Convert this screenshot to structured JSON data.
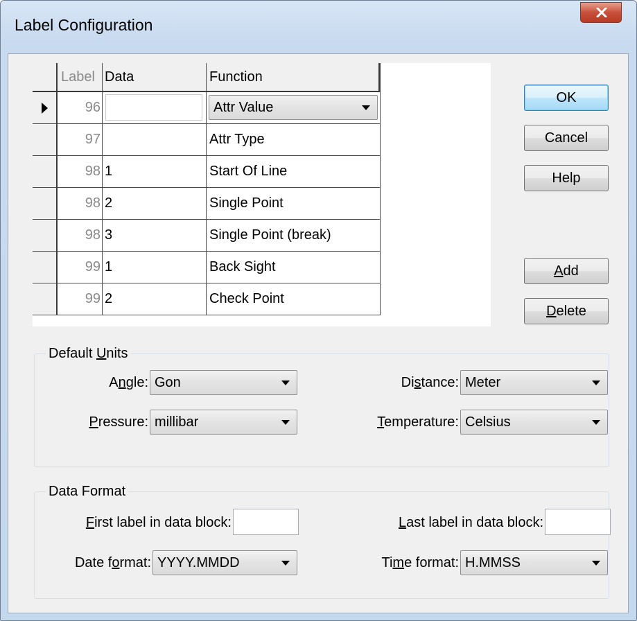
{
  "window": {
    "title": "Label Configuration",
    "close_symbol": "✕"
  },
  "table": {
    "headers": {
      "label": "Label",
      "data": "Data",
      "function": "Function"
    },
    "rows": [
      {
        "label": "96",
        "data": "",
        "function": "Attr Value",
        "current": true,
        "editing": true
      },
      {
        "label": "97",
        "data": "",
        "function": "Attr Type"
      },
      {
        "label": "98",
        "data": "1",
        "function": "Start Of Line"
      },
      {
        "label": "98",
        "data": "2",
        "function": "Single Point"
      },
      {
        "label": "98",
        "data": "3",
        "function": "Single Point (break)"
      },
      {
        "label": "99",
        "data": "1",
        "function": "Back Sight"
      },
      {
        "label": "99",
        "data": "2",
        "function": "Check Point"
      }
    ]
  },
  "buttons": {
    "ok": "OK",
    "cancel": "Cancel",
    "help": "Help",
    "add": {
      "pre": "",
      "mnemonic": "A",
      "post": "dd"
    },
    "delete": {
      "pre": "",
      "mnemonic": "D",
      "post": "elete"
    }
  },
  "default_units": {
    "title": {
      "pre": "Default ",
      "mnemonic": "U",
      "post": "nits"
    },
    "angle": {
      "label": {
        "pre": "A",
        "mnemonic": "n",
        "post": "gle:"
      },
      "value": "Gon"
    },
    "distance": {
      "label": {
        "pre": "Di",
        "mnemonic": "s",
        "post": "tance:"
      },
      "value": "Meter"
    },
    "pressure": {
      "label": {
        "pre": "",
        "mnemonic": "P",
        "post": "ressure:"
      },
      "value": "millibar"
    },
    "temperature": {
      "label": {
        "pre": "",
        "mnemonic": "T",
        "post": "emperature:"
      },
      "value": "Celsius"
    }
  },
  "data_format": {
    "title": "Data Format",
    "first_label": {
      "label": {
        "pre": "",
        "mnemonic": "F",
        "post": "irst label in data block:"
      },
      "value": ""
    },
    "last_label": {
      "label": {
        "pre": "",
        "mnemonic": "L",
        "post": "ast label in data block:"
      },
      "value": ""
    },
    "date_format": {
      "label": {
        "pre": "Date f",
        "mnemonic": "o",
        "post": "rmat:"
      },
      "value": "YYYY.MMDD"
    },
    "time_format": {
      "label": {
        "pre": "Ti",
        "mnemonic": "m",
        "post": "e format:"
      },
      "value": "H.MMSS"
    }
  }
}
